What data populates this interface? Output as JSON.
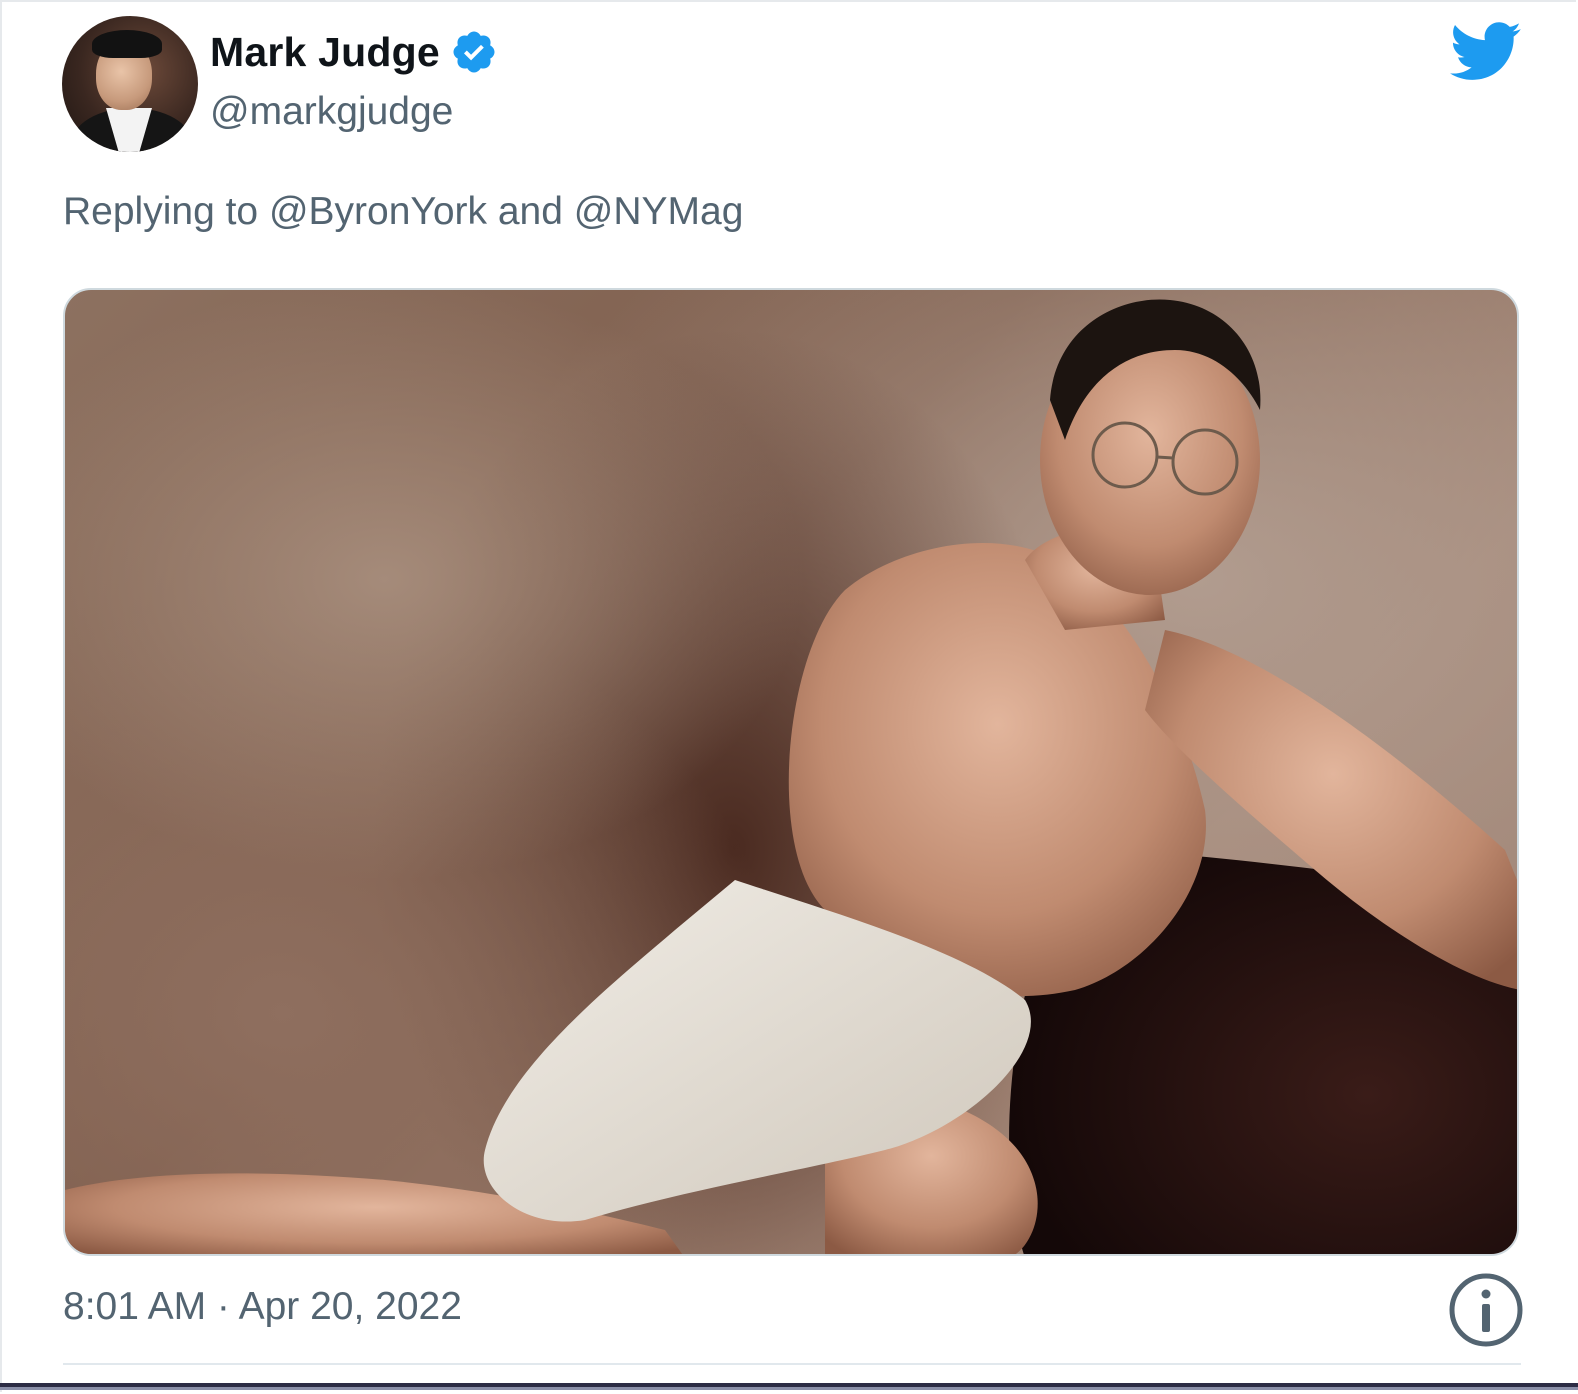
{
  "tweet": {
    "author": {
      "display_name": "Mark Judge",
      "handle": "@markgjudge",
      "verified": true,
      "avatar_icon": "person-avatar"
    },
    "reply_context": "Replying to @ByronYork and @NYMag",
    "media": {
      "type": "photo",
      "alt": ""
    },
    "timestamp": "8:01 AM · Apr 20, 2022",
    "icons": {
      "brand": "twitter-bird-icon",
      "verified": "verified-badge-icon",
      "info": "info-icon"
    }
  },
  "colors": {
    "text_primary": "#0f1419",
    "text_secondary": "#536471",
    "twitter_blue": "#1d9bf0",
    "border": "#cfd9de"
  }
}
